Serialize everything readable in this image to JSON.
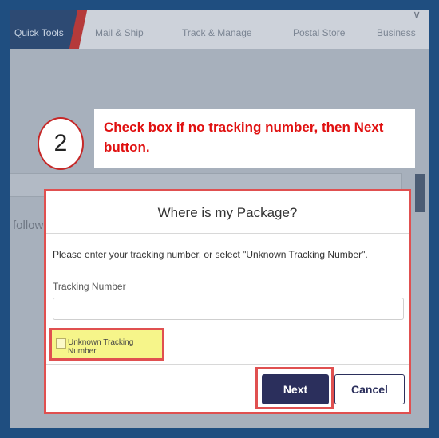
{
  "nav": {
    "active": "Quick Tools",
    "items": [
      "Mail & Ship",
      "Track & Manage",
      "Postal Store",
      "Business"
    ]
  },
  "background": {
    "partial_text": "followi"
  },
  "callout": {
    "step": "2",
    "text": "Check box if no tracking number, then Next button."
  },
  "modal": {
    "title": "Where is my Package?",
    "description": "Please enter your tracking number, or select \"Unknown Tracking Number\".",
    "tracking_label": "Tracking Number",
    "tracking_value": "",
    "unknown_label": "Unknown Tracking Number",
    "unknown_checked": false,
    "next_label": "Next",
    "cancel_label": "Cancel"
  },
  "colors": {
    "accent_red": "#e05050",
    "primary_button": "#2b2f5c",
    "highlight": "#f6f58a",
    "callout_text": "#e01010"
  }
}
